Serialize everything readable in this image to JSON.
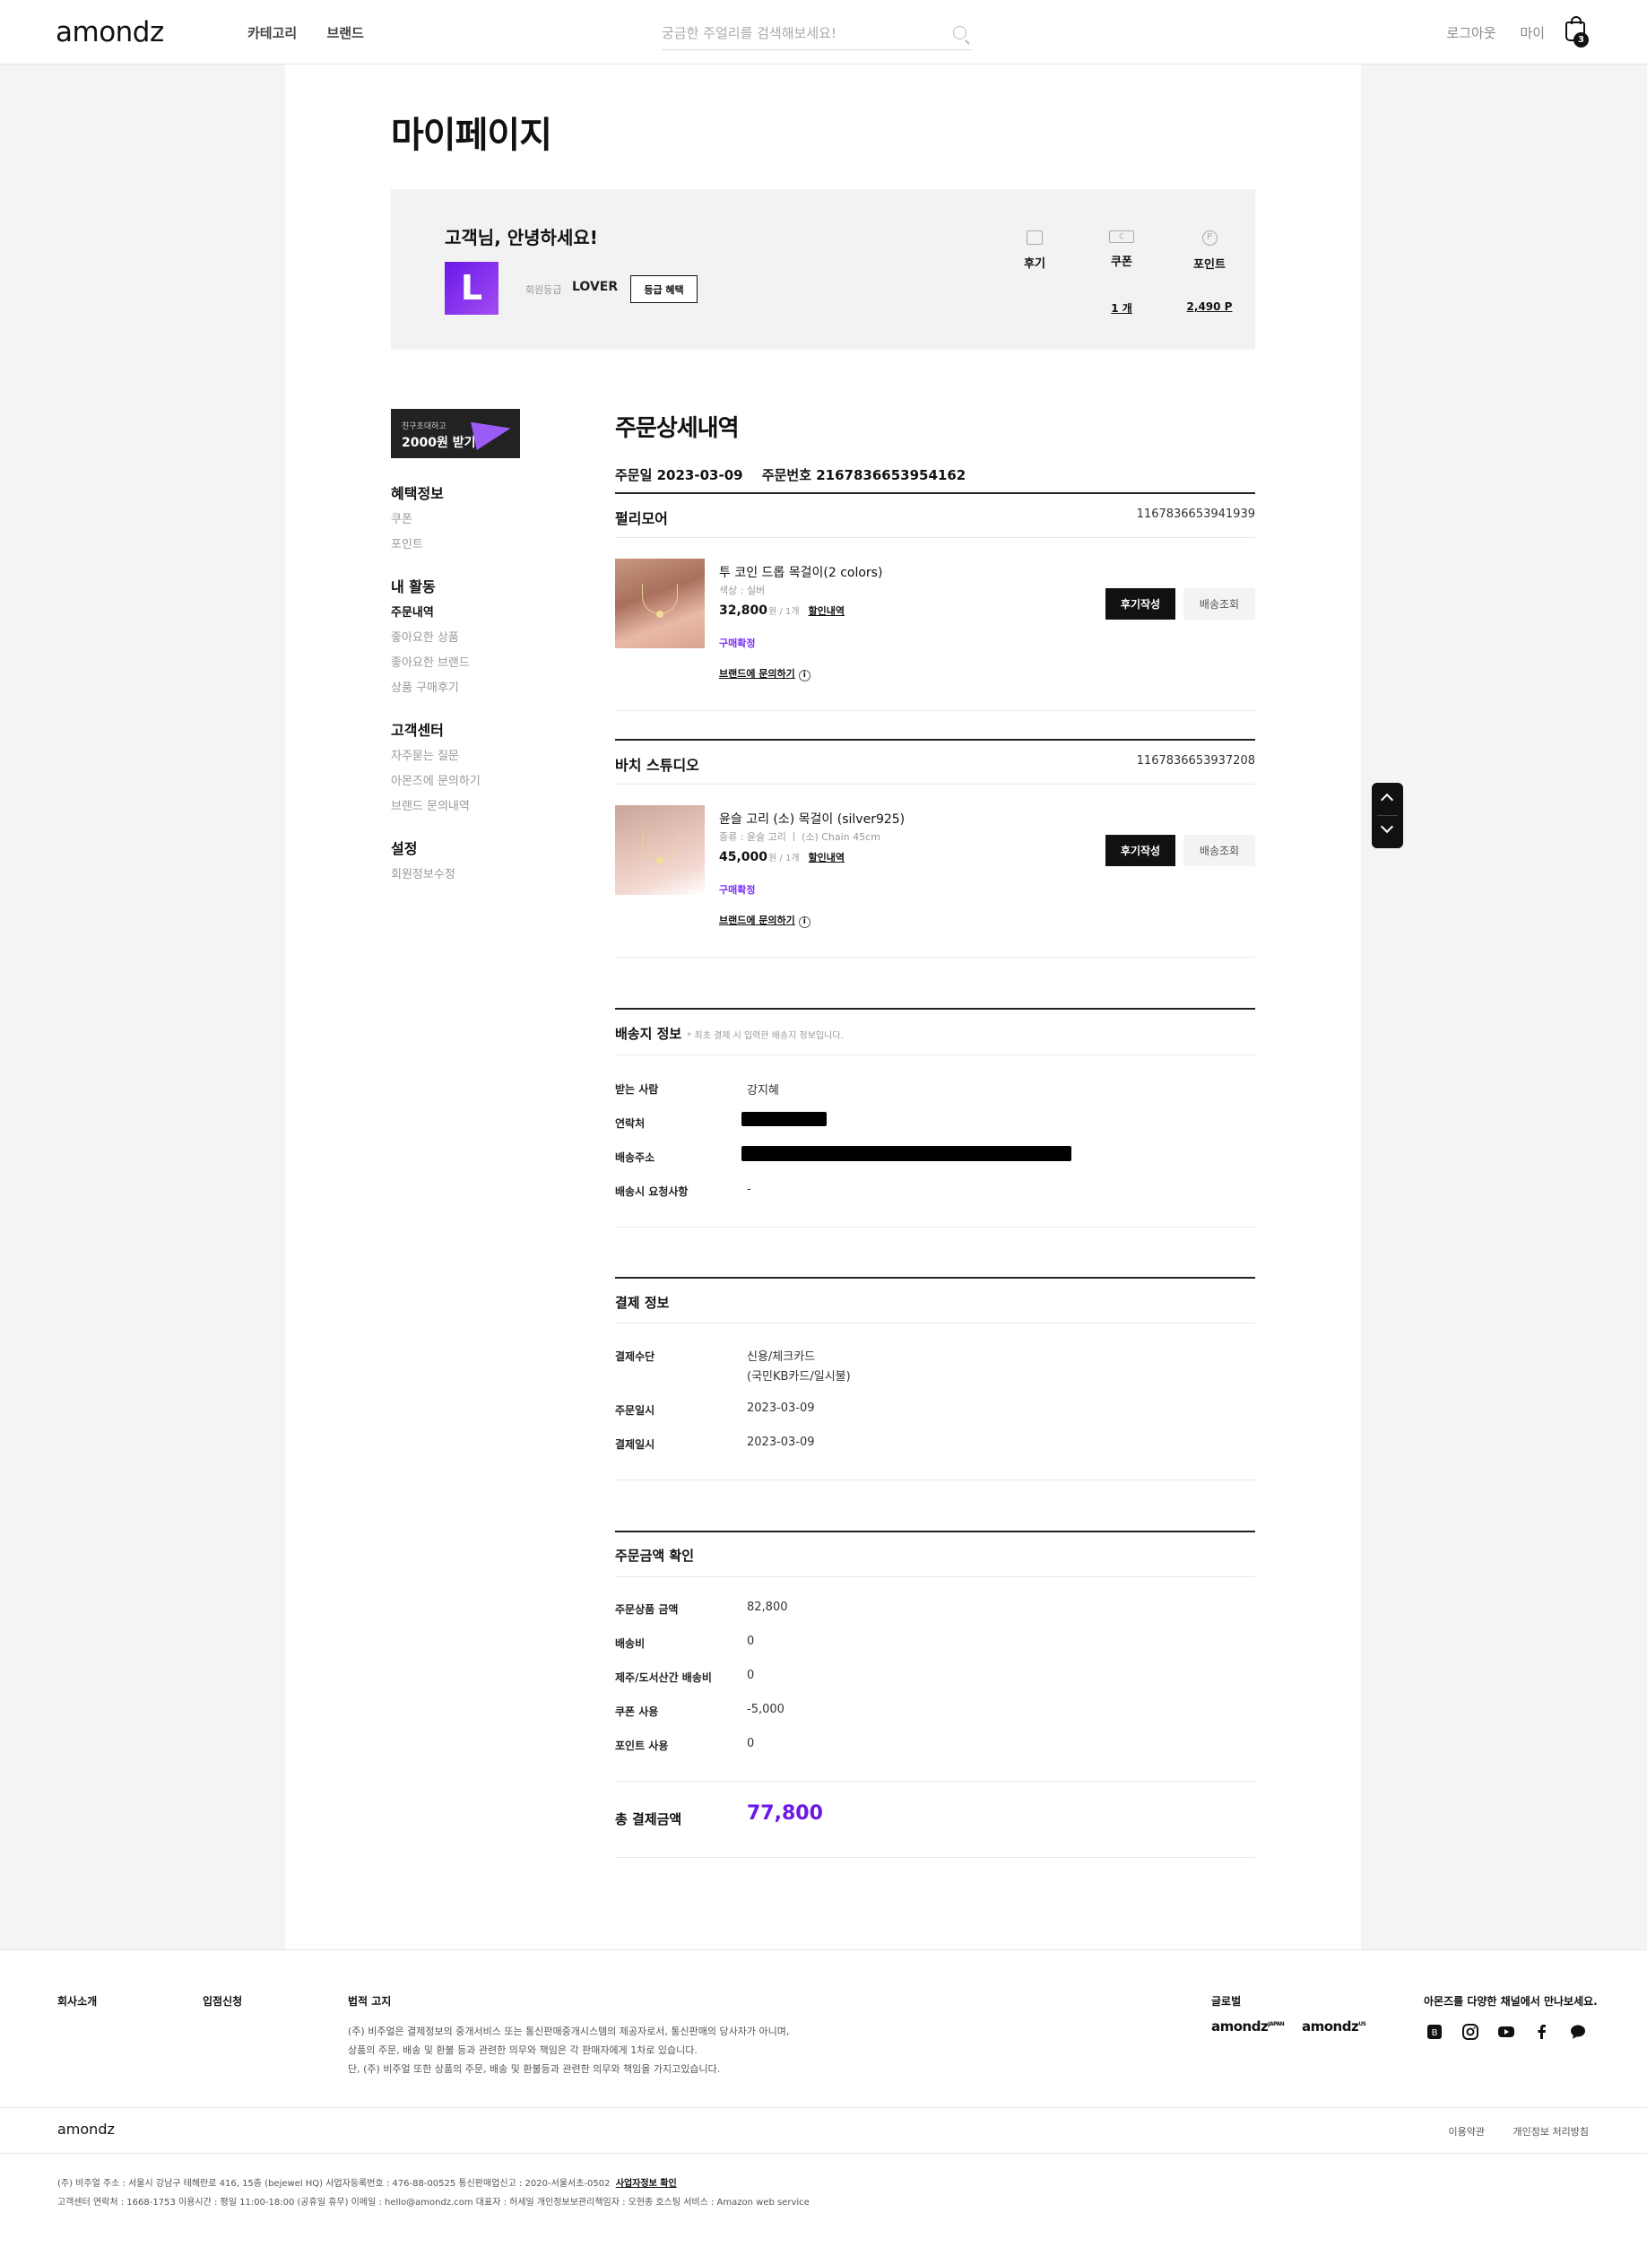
{
  "header": {
    "logo": "amondz",
    "nav": [
      "카테고리",
      "브랜드"
    ],
    "search_placeholder": "궁금한 주얼리를 검색해보세요!",
    "logout": "로그아웃",
    "my": "마이",
    "cart_count": "3"
  },
  "page_title": "마이페이지",
  "profile": {
    "greeting": "고객님, 안녕하세요!",
    "grade_letter": "L",
    "grade_label": "회원등급",
    "grade_name": "LOVER",
    "grade_button": "등급 혜택",
    "stats": [
      {
        "label": "후기",
        "value": ""
      },
      {
        "label": "쿠폰",
        "value": "1 개"
      },
      {
        "label": "포인트",
        "value": "2,490 P"
      }
    ]
  },
  "sidebar": {
    "invite_small": "친구초대하고",
    "invite_big": "2000원 받기",
    "sections": [
      {
        "title": "혜택정보",
        "items": [
          "쿠폰",
          "포인트"
        ]
      },
      {
        "title": "내 활동",
        "items": [
          "주문내역",
          "좋아요한 상품",
          "좋아요한 브랜드",
          "상품 구매후기"
        ]
      },
      {
        "title": "고객센터",
        "items": [
          "자주묻는 질문",
          "아몬즈에 문의하기",
          "브랜드 문의내역"
        ]
      },
      {
        "title": "설정",
        "items": [
          "회원정보수정"
        ]
      }
    ]
  },
  "order": {
    "title": "주문상세내역",
    "date_label": "주문일 2023-03-09",
    "number_label": "주문번호 2167836653954162",
    "shipments": [
      {
        "brand": "펄리모어",
        "number": "1167836653941939",
        "product": "투 코인 드롭 목걸이(2 colors)",
        "option": "색상 : 실버",
        "price": "32,800",
        "unit": "원 / 1개",
        "discount": "할인내역",
        "status": "구매확정",
        "inquiry": "브랜드에 문의하기",
        "review_btn": "후기작성",
        "track_btn": "배송조회"
      },
      {
        "brand": "바치 스튜디오",
        "number": "1167836653937208",
        "product": "윤슬 고리 (소) 목걸이 (silver925)",
        "option": "종류 : 윤슬 고리 ㅣ (소) Chain 45cm",
        "price": "45,000",
        "unit": "원 / 1개",
        "discount": "할인내역",
        "status": "구매확정",
        "inquiry": "브랜드에 문의하기",
        "review_btn": "후기작성",
        "track_btn": "배송조회"
      }
    ]
  },
  "shipping": {
    "title": "배송지 정보",
    "note": "* 최초 결제 시 입력한 배송지 정보입니다.",
    "rows": [
      {
        "key": "받는 사람",
        "value": "강지혜"
      },
      {
        "key": "연락처",
        "value": ""
      },
      {
        "key": "배송주소",
        "value": ""
      },
      {
        "key": "배송시 요청사항",
        "value": "-"
      }
    ]
  },
  "payment": {
    "title": "결제 정보",
    "method_label": "결제수단",
    "method_line1": "신용/체크카드",
    "method_line2": "(국민KB카드/일시불)",
    "rows": [
      {
        "key": "주문일시",
        "value": "2023-03-09"
      },
      {
        "key": "결제일시",
        "value": "2023-03-09"
      }
    ]
  },
  "amount": {
    "title": "주문금액 확인",
    "rows": [
      {
        "key": "주문상품 금액",
        "value": "82,800"
      },
      {
        "key": "배송비",
        "value": "0"
      },
      {
        "key": "제주/도서산간 배송비",
        "value": "0"
      },
      {
        "key": "쿠폰 사용",
        "value": "-5,000"
      },
      {
        "key": "포인트 사용",
        "value": "0"
      }
    ],
    "total_label": "총 결제금액",
    "total_value": "77,800"
  },
  "footer": {
    "company": "회사소개",
    "apply": "입점신청",
    "legal_title": "법적 고지",
    "legal_lines": [
      "(주) 비주얼은 결제정보의 중개서비스 또는 통신판매중개시스템의 제공자로서, 통신판매의 당사자가 아니며,",
      "상품의 주문, 배송 및 환불 등과 관련한 의무와 책임은 각 판매자에게 1차로 있습니다.",
      "단, (주) 비주얼 또한 상품의 주문, 배송 및 환불등과 관련한 의무와 책임을 가지고있습니다."
    ],
    "global_title": "글로벌",
    "global_brands": [
      "amondz",
      "amondz"
    ],
    "global_marks": [
      "JAPAN",
      "US"
    ],
    "channel_title": "아몬즈를 다양한 채널에서 만나보세요.",
    "logo": "amondz",
    "links": [
      "이용약관",
      "개인정보 처리방침"
    ],
    "info_line1": "(주) 비주얼   주소 : 서울시 강남구 테헤란로 416, 15층 (bejewel HQ)   사업자등록번호 : 476-88-00525   통신판매업신고 : 2020-서울서초-0502",
    "info_link": "사업자정보 확인",
    "info_line2": "고객센터 연락처 : 1668-1753   이용시간 : 평일 11:00-18:00 (공휴일 휴무)   이메일 : hello@amondz.com   대표자 : 허세일   개인정보보관리책임자 : 오현종   호스팅 서비스 : Amazon web service"
  }
}
